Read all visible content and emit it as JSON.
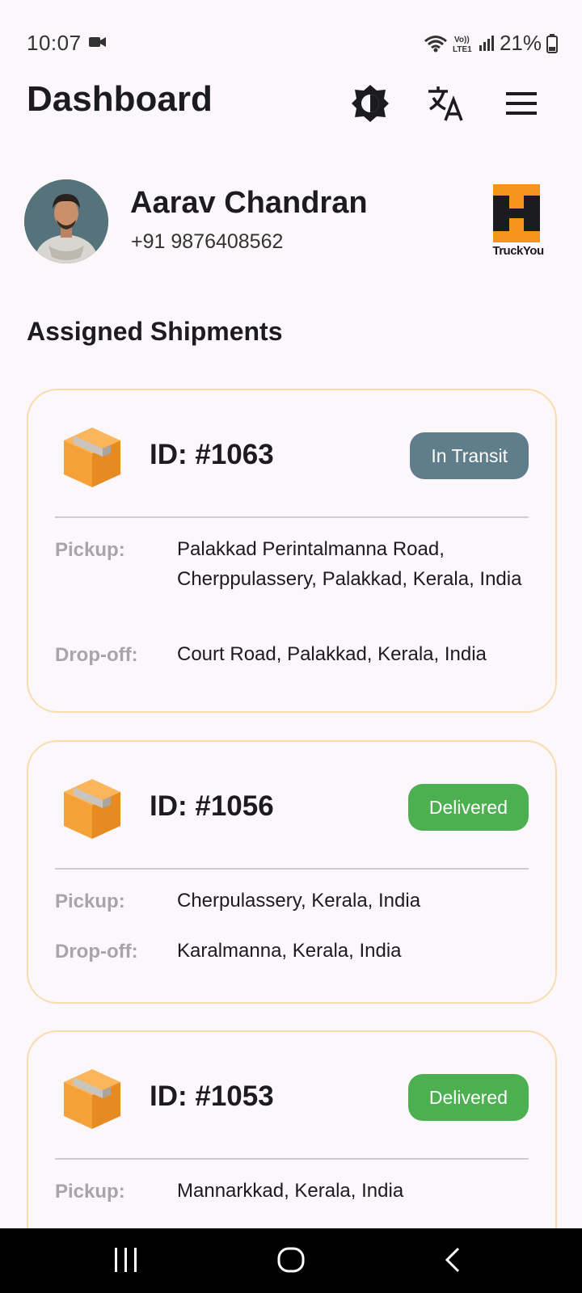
{
  "status_bar": {
    "time": "10:07",
    "battery": "21%",
    "icons": [
      "video-camera-icon",
      "wifi-icon",
      "volte-icon",
      "signal-icon",
      "battery-icon"
    ]
  },
  "app_bar": {
    "title": "Dashboard",
    "icons": [
      "theme-toggle-icon",
      "translate-icon",
      "menu-icon"
    ]
  },
  "profile": {
    "name": "Aarav Chandran",
    "phone": "+91 9876408562",
    "brand": "TruckYou"
  },
  "section_title": "Assigned Shipments",
  "labels": {
    "pickup": "Pickup:",
    "dropoff": "Drop-off:"
  },
  "shipments": [
    {
      "id": "ID: #1063",
      "status": "In Transit",
      "pickup": "Palakkad Perintalmanna Road, Cherppulassery, Palakkad, Kerala, India",
      "dropoff": "Court Road, Palakkad, Kerala, India"
    },
    {
      "id": "ID: #1056",
      "status": "Delivered",
      "pickup": "Cherpulassery, Kerala, India",
      "dropoff": "Karalmanna, Kerala, India"
    },
    {
      "id": "ID: #1053",
      "status": "Delivered",
      "pickup": "Mannarkkad, Kerala, India"
    }
  ],
  "colors": {
    "background": "#fcf7fb",
    "card_border": "#f8dcb0",
    "in_transit": "#607d8b",
    "delivered": "#4caf50",
    "box": "#f4a13a",
    "brand_orange": "#f7941d"
  }
}
